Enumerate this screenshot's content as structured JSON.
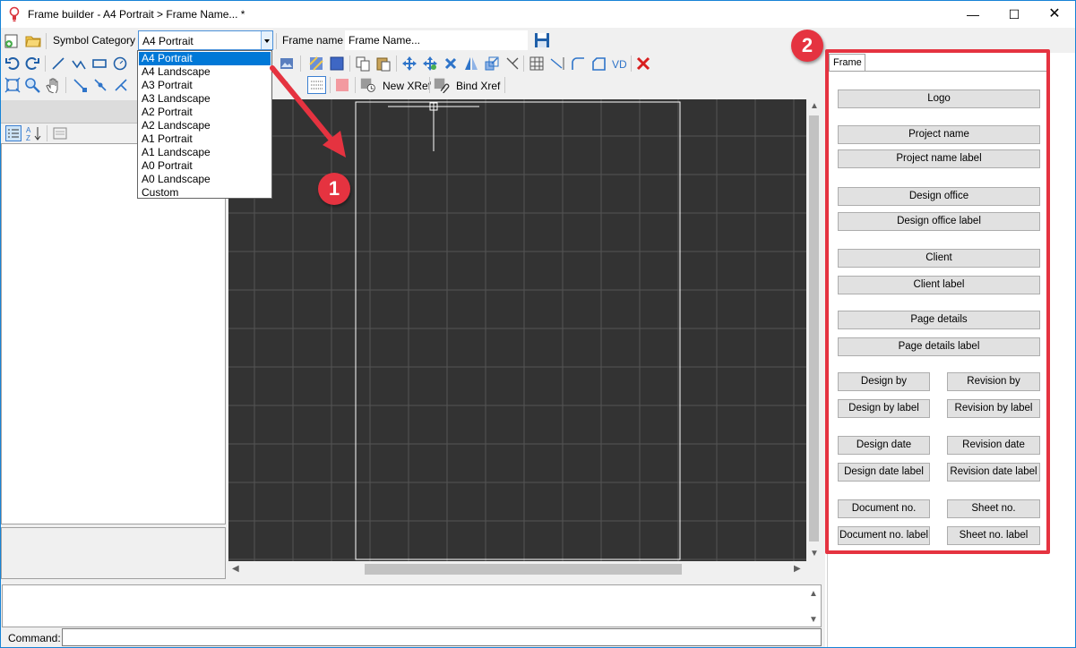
{
  "window": {
    "title": "Frame builder - A4 Portrait > Frame Name... *",
    "minimize_glyph": "—",
    "maximize_glyph": "☐",
    "close_glyph": "✕"
  },
  "toolbar": {
    "symbol_category_label": "Symbol Category",
    "symbol_category_value": "A4 Portrait",
    "frame_name_label": "Frame name",
    "frame_name_value": "Frame Name...",
    "new_xref_label": "New XRef",
    "bind_xref_label": "Bind Xref"
  },
  "dropdown": {
    "options": [
      "A4 Portrait",
      "A4 Landscape",
      "A3 Portrait",
      "A3 Landscape",
      "A2 Portrait",
      "A2 Landscape",
      "A1 Portrait",
      "A1 Landscape",
      "A0 Portrait",
      "A0 Landscape",
      "Custom"
    ],
    "selected": "A4 Portrait"
  },
  "command": {
    "label": "Command:"
  },
  "frame_panel": {
    "tab_label": "Frame",
    "buttons": {
      "logo": "Logo",
      "project_name": "Project name",
      "project_name_label": "Project name label",
      "design_office": "Design office",
      "design_office_label": "Design office label",
      "client": "Client",
      "client_label": "Client label",
      "page_details": "Page details",
      "page_details_label": "Page details label",
      "design_by": "Design by",
      "revision_by": "Revision by",
      "design_by_label": "Design by label",
      "revision_by_label": "Revision by label",
      "design_date": "Design date",
      "revision_date": "Revision date",
      "design_date_label": "Design date label",
      "revision_date_label": "Revision date label",
      "document_no": "Document no.",
      "sheet_no": "Sheet no.",
      "document_no_label": "Document no. label",
      "sheet_no_label": "Sheet no. label"
    }
  },
  "annotations": {
    "badge_1": "1",
    "badge_2": "2"
  },
  "colors": {
    "accent": "#0078d7",
    "annotation_red": "#e53340",
    "canvas_bg": "#333333",
    "grid_line": "#555555",
    "frame_border": "#ffffff"
  }
}
